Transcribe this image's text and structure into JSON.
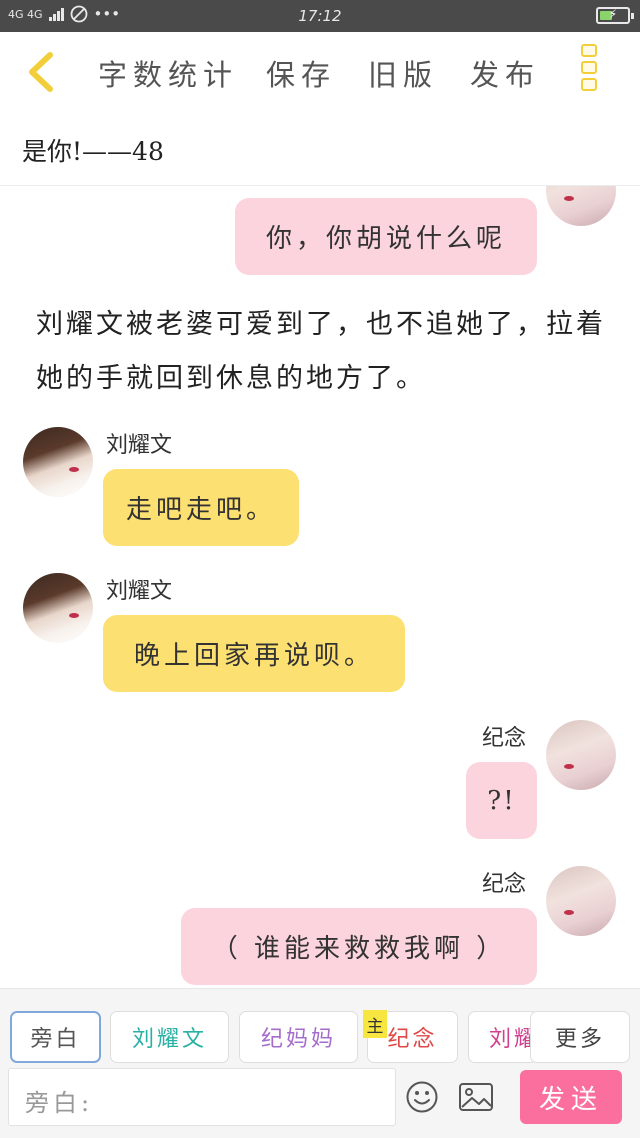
{
  "status_bar": {
    "network": "4G 4G",
    "more": "•••",
    "time": "17:12"
  },
  "toolbar": {
    "word_count": "字数统计",
    "save": "保存",
    "old_version": "旧版",
    "publish": "发布"
  },
  "chapter_title": "是你!——48",
  "messages": {
    "m1": "你，你胡说什么呢",
    "narration": "刘耀文被老婆可爱到了，也不追她了，拉着她的手就回到休息的地方了。",
    "m2_name": "刘耀文",
    "m2": "走吧走吧。",
    "m3_name": "刘耀文",
    "m3": "晚上回家再说呗。",
    "m4_name": "纪念",
    "m4": "?!",
    "m5_name": "纪念",
    "m5": "（ 谁能来救救我啊 ）"
  },
  "characters": {
    "narrator": "旁白",
    "liu": "刘耀文",
    "ji_mom": "纪妈妈",
    "main_badge": "主",
    "ji": "纪念",
    "liu_partial": "刘耀",
    "more": "更多"
  },
  "input": {
    "placeholder": "旁白:",
    "send": "发送"
  },
  "colors": {
    "pink_bubble": "#fcd4dd",
    "yellow_bubble": "#fde072",
    "send": "#fb6f9e",
    "accent_yellow": "#f2cf3a",
    "liu_name": "#2bb0a5",
    "ji_mom_name": "#a46ccb",
    "ji_name": "#e04848",
    "liu_partial_name": "#d0408e"
  }
}
